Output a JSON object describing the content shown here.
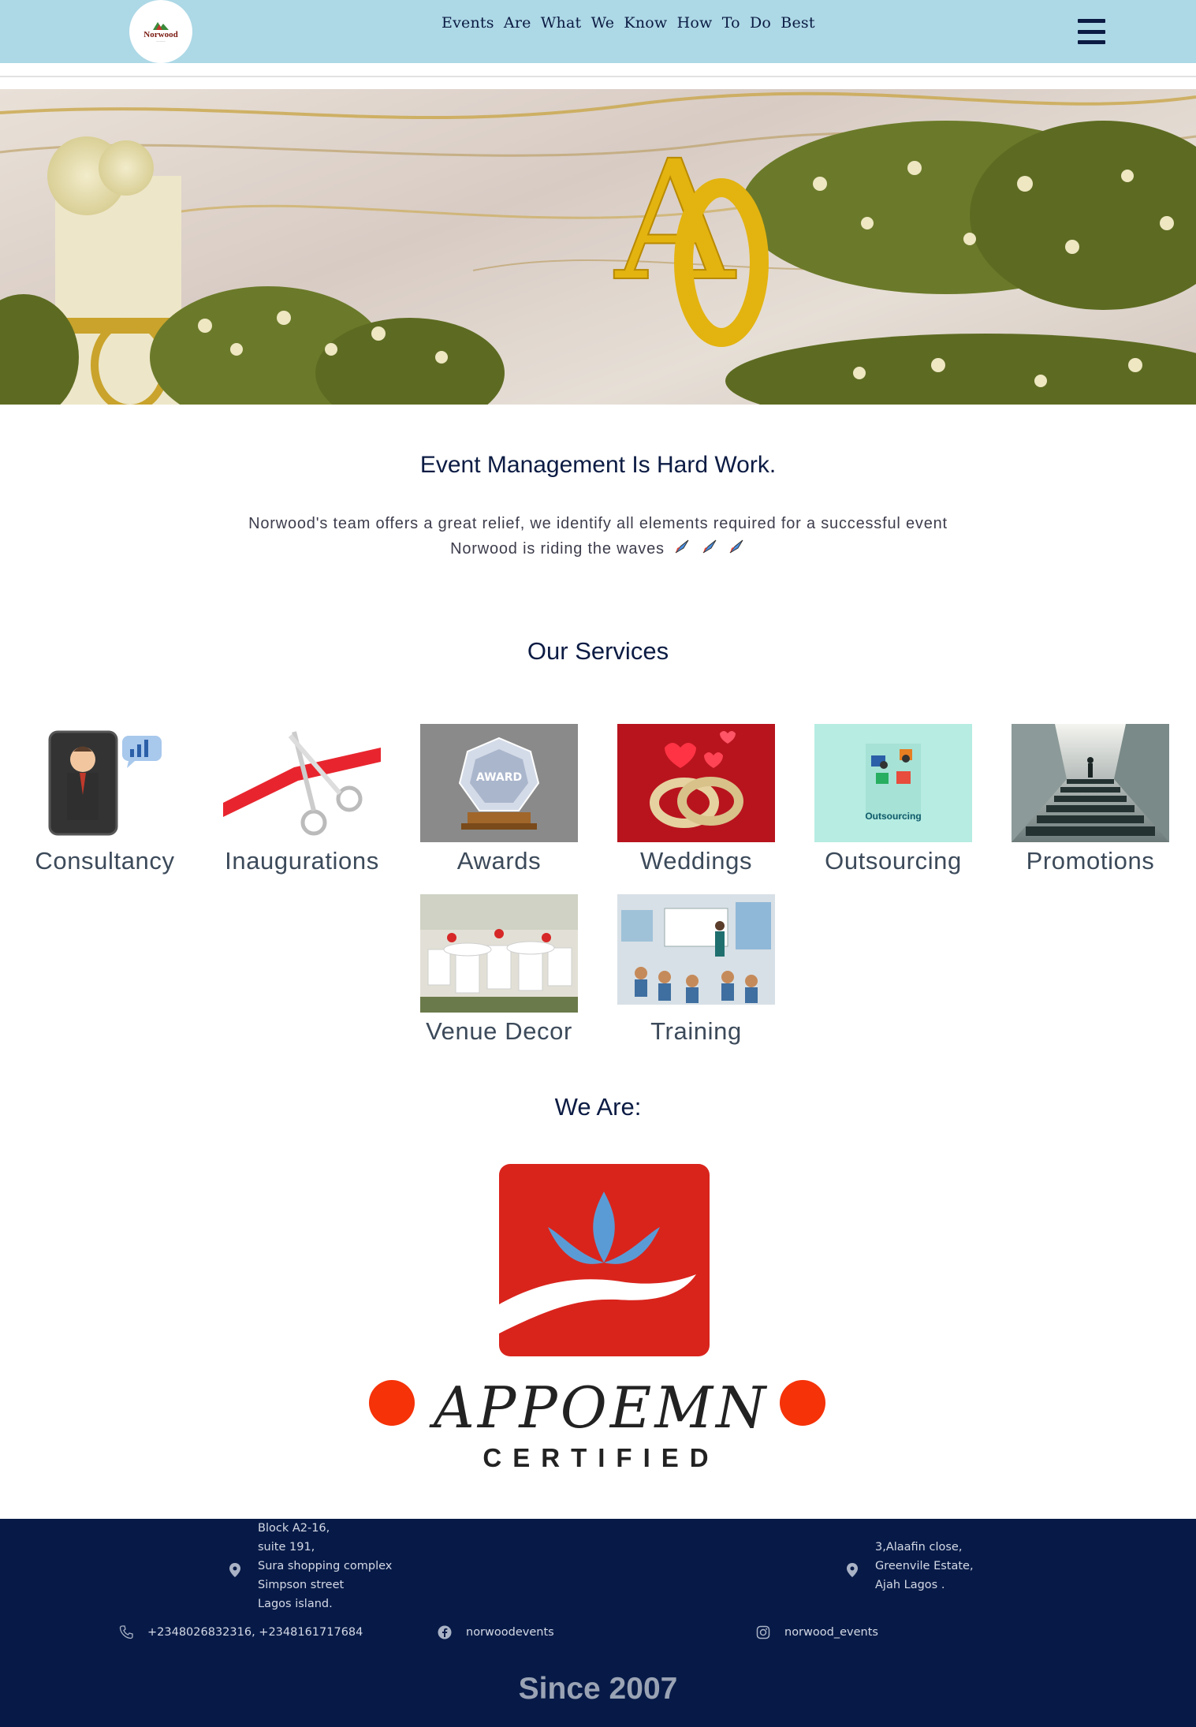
{
  "header": {
    "logo_text": "Norwood",
    "tagline": "Events Are What We Know How To Do Best"
  },
  "hero": {
    "monogram": "AO"
  },
  "intro": {
    "title": "Event Management Is Hard Work.",
    "line1": "Norwood's team offers a great relief, we identify all elements required for a successful event",
    "line2": "Norwood is riding the waves"
  },
  "services": {
    "title": "Our Services",
    "items": [
      {
        "label": "Consultancy",
        "icon": "consultant-icon"
      },
      {
        "label": "Inaugurations",
        "icon": "ribbon-scissors-icon"
      },
      {
        "label": "Awards",
        "icon": "award-trophy-icon"
      },
      {
        "label": "Weddings",
        "icon": "wedding-rings-icon"
      },
      {
        "label": "Outsourcing",
        "icon": "outsourcing-icon",
        "image_text": "Outsourcing"
      },
      {
        "label": "Promotions",
        "icon": "stairs-icon"
      },
      {
        "label": "Venue Decor",
        "icon": "venue-decor-icon"
      },
      {
        "label": "Training",
        "icon": "training-icon"
      }
    ]
  },
  "we_are": {
    "title": "We Are:",
    "cert_name": "APPOEMN",
    "cert_sub": "CERTIFIED"
  },
  "footer": {
    "address1": [
      "Block A2-16,",
      "suite 191,",
      "Sura shopping complex",
      "Simpson street",
      "Lagos island."
    ],
    "address2": [
      "3,Alaafin close,",
      "Greenvile Estate,",
      "Ajah Lagos ."
    ],
    "phone": "+2348026832316, +2348161717684",
    "facebook": "norwoodevents",
    "instagram": "norwood_events",
    "since": "Since 2007"
  },
  "colors": {
    "header_bg": "#add8e6",
    "navy": "#0b1b43",
    "footer_bg": "#071a47",
    "cert_red": "#d9241c",
    "cert_dot": "#f53208"
  }
}
